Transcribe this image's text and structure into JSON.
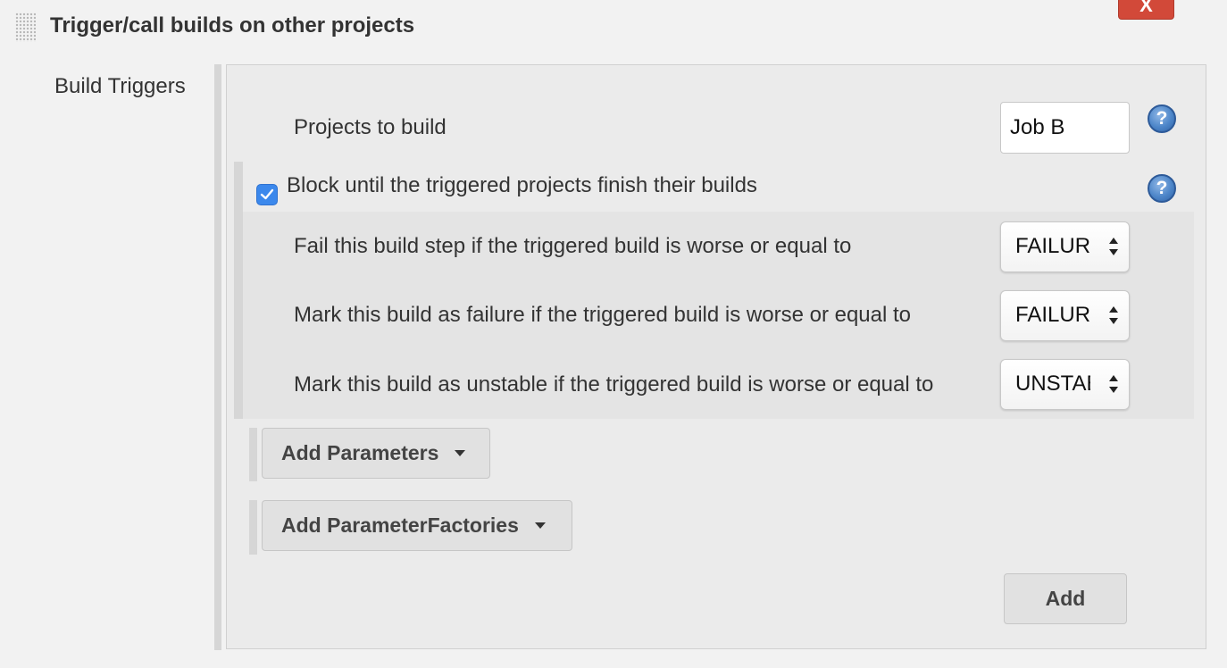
{
  "section": {
    "title": "Trigger/call builds on other projects",
    "delete_label": "X"
  },
  "build_triggers": {
    "label": "Build Triggers",
    "projects_label": "Projects to build",
    "projects_value": "Job B",
    "block": {
      "checked": true,
      "label": "Block until the triggered projects finish their builds",
      "rows": [
        {
          "label": "Fail this build step if the triggered build is worse or equal to",
          "value": "FAILURE"
        },
        {
          "label": "Mark this build as failure if the triggered build is worse or equal to",
          "value": "FAILURE"
        },
        {
          "label": "Mark this build as unstable if the triggered build is worse or equal to",
          "value": "UNSTABLE"
        }
      ]
    },
    "add_parameters_label": "Add Parameters",
    "add_parameter_factories_label": "Add ParameterFactories",
    "add_label": "Add"
  },
  "help_icon_text": "?",
  "colors": {
    "delete_button": "#d24939",
    "checkbox": "#3b88ec",
    "help_icon": "#4d86c9"
  }
}
